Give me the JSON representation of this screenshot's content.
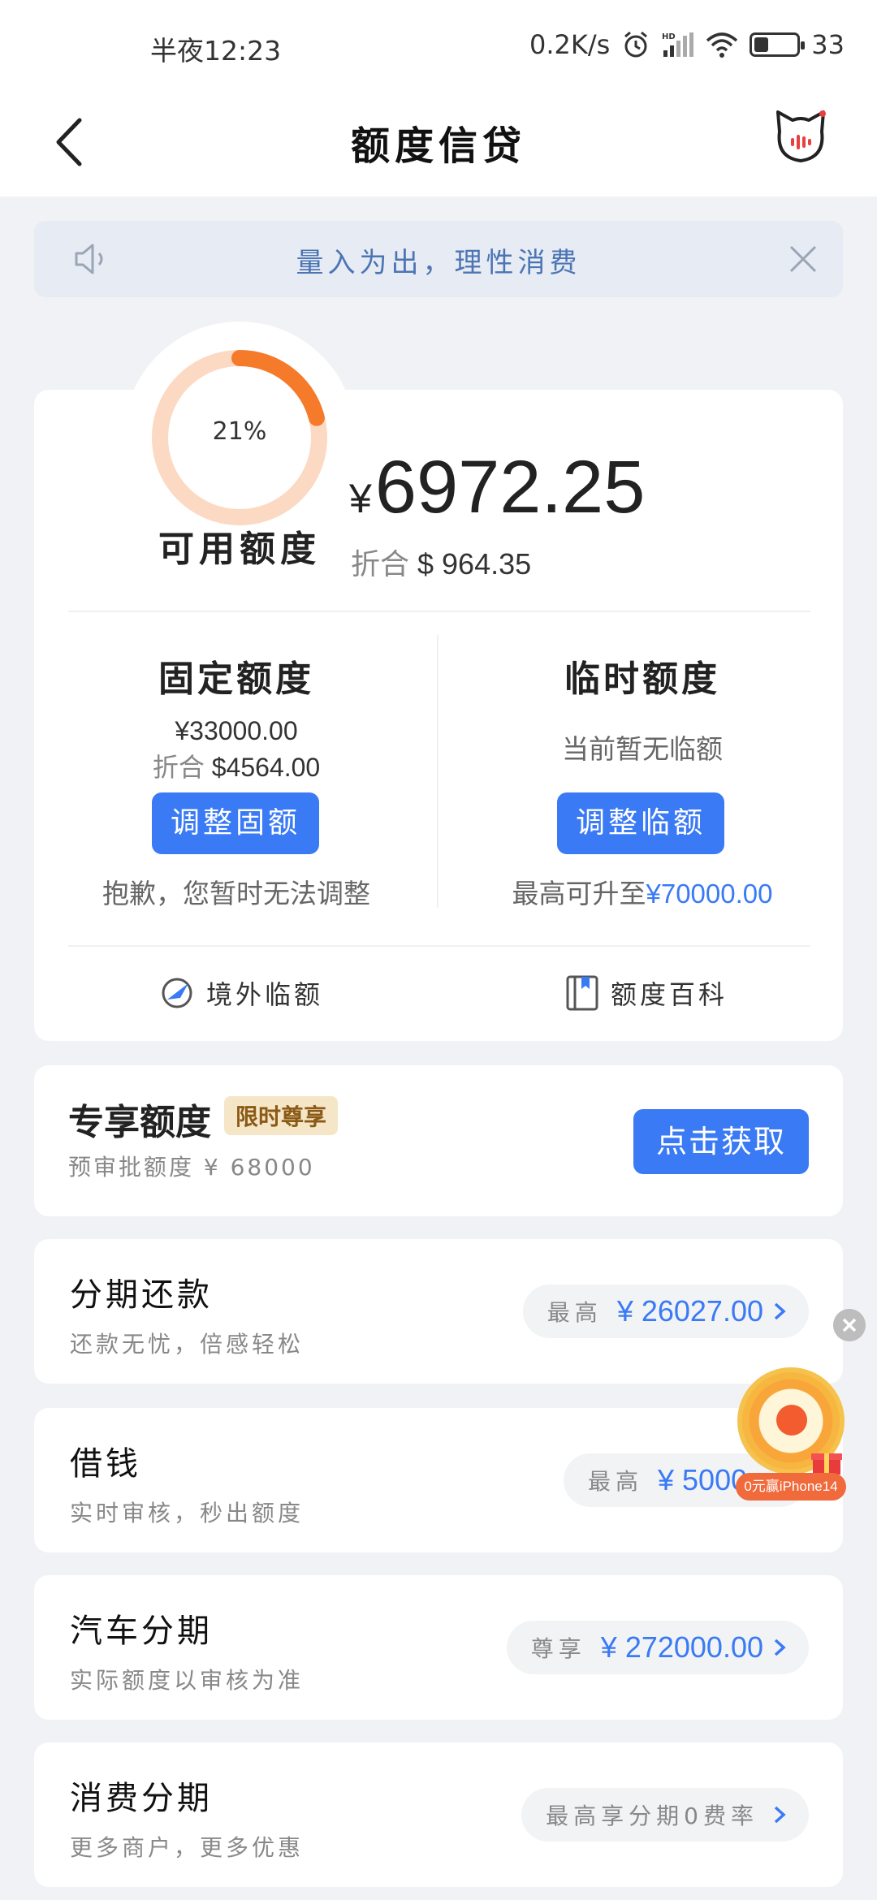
{
  "status_bar": {
    "time": "半夜12:23",
    "net_speed": "0.2K/s",
    "battery": "33",
    "battery_level": 0.33
  },
  "header": {
    "title": "额度信贷"
  },
  "notice": {
    "text": "量入为出，理性消费"
  },
  "credit": {
    "percent_label": "21%",
    "percent": 21,
    "available_label": "可用额度",
    "currency_symbol": "¥",
    "amount": "6972.25",
    "converted_label": "折合",
    "converted_value": "$ 964.35"
  },
  "fixed": {
    "title": "固定额度",
    "amount": "¥33000.00",
    "converted_label": "折合",
    "converted_value": "$4564.00",
    "button": "调整固额",
    "note": "抱歉，您暂时无法调整"
  },
  "temporary": {
    "title": "临时额度",
    "amount": "当前暂无临额",
    "button": "调整临额",
    "note_prefix": "最高可升至",
    "note_value": "¥70000.00"
  },
  "links": {
    "overseas": "境外临额",
    "encyclopedia": "额度百科"
  },
  "exclusive": {
    "title": "专享额度",
    "badge": "限时尊享",
    "sub": "预审批额度 ¥ 68000",
    "button": "点击获取"
  },
  "products": [
    {
      "title": "分期还款",
      "sub": "还款无忧，倍感轻松",
      "pill_label": "最高",
      "pill_value": "¥ 26027.00"
    },
    {
      "title": "借钱",
      "sub": "实时审核，秒出额度",
      "pill_label": "最高",
      "pill_value": "¥ 5000"
    },
    {
      "title": "汽车分期",
      "sub": "实际额度以审核为准",
      "pill_label": "尊享",
      "pill_value": "¥ 272000.00"
    },
    {
      "title": "消费分期",
      "sub": "更多商户，更多优惠",
      "pill_label": "最高享分期0费率",
      "pill_value": ""
    }
  ],
  "floating": {
    "tag": "0元赢iPhone14"
  },
  "colors": {
    "accent": "#3a7af5",
    "ring_fg": "#f57a2a",
    "ring_bg": "#fcd9c2",
    "notice_text": "#4c75b4"
  }
}
